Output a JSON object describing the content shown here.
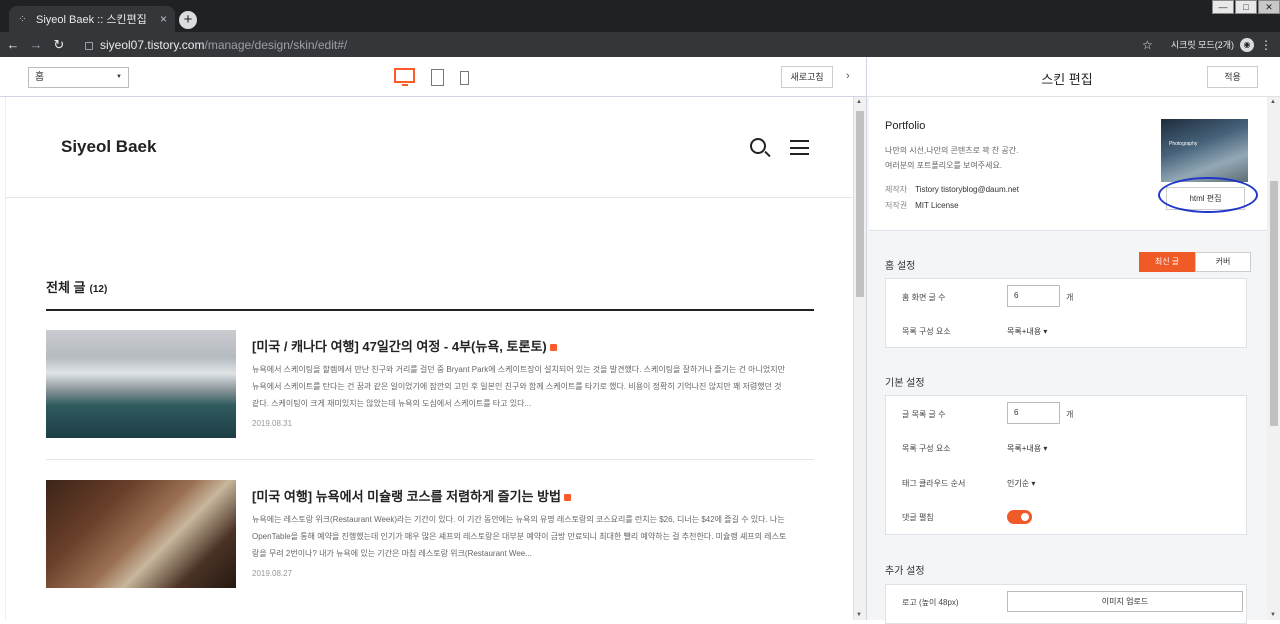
{
  "browser": {
    "tab_title": "Siyeol Baek :: 스킨편집",
    "tab_close": "×",
    "new_tab": "+",
    "url_host": "siyeol07.tistory.com",
    "url_path": "/manage/design/skin/edit#/",
    "incognito_label": "시크릿 모드(2개)",
    "window_controls": [
      "—",
      "□",
      "✕"
    ]
  },
  "toolbar": {
    "page_select": "홈",
    "refresh_label": "새로고침",
    "collapse_icon": "›"
  },
  "preview": {
    "blog_title": "Siyeol Baek",
    "section_title": "전체 글",
    "section_count": "(12)",
    "posts": [
      {
        "title": "[미국 / 캐나다 여행] 47일간의 여정 - 4부(뉴욕, 토론토)",
        "excerpt": "뉴욕에서 스케이팅을 할렘에서 만난 친구와 거리를 걸던 중 Bryant Park에 스케이트장이 설치되어 있는 것을 발견했다. 스케이팅을 잘하거나 즐기는 건 아니었지만 뉴욕에서 스케이트를 탄다는 건 꿈과 같은 일이었기에 잠깐의 고민 후 일본인 친구와 함께 스케이트를 타기로 했다. 비용이 정확히 기억나진 않지만 꽤 저렴했던 것 같다. 스케이팅이 크게 재미있지는 않았는데 뉴욕의 도심에서 스케이트를 타고 있다...",
        "date": "2019.08.31"
      },
      {
        "title": "[미국 여행] 뉴욕에서 미슐랭 코스를 저렴하게 즐기는 방법",
        "excerpt": "뉴욕에는 레스토랑 위크(Restaurant Week)라는 기간이 있다. 이 기간 동안에는 뉴욕의 유명 레스토랑의 코스요리를 런치는 $26, 디너는 $42에 즐길 수 있다. 나는 OpenTable을 통해 예약을 진행했는데 인기가 매우 많은 셰프의 레스토랑은 대부분 예약이 금방 만료되니 최대한 빨리 예약하는 걸 추천한다. 미슐랭 셰프의 레스토랑을 무려 2번이나? 내가 뉴욕에 있는 기간은 마침 레스토랑 위크(Restaurant Wee...",
        "date": "2019.08.27"
      }
    ]
  },
  "panel": {
    "title": "스킨 편집",
    "apply_label": "적용",
    "skin": {
      "name": "Portfolio",
      "desc_line1": "나만의 시선,나만의 콘텐츠로 꽉 찬 공간.",
      "desc_line2": "여러분의 포트폴리오를 보여주세요.",
      "maker_label": "제작자",
      "maker_value": "Tistory tistoryblog@daum.net",
      "license_label": "저작권",
      "license_value": "MIT License",
      "thumb_text": "Photography",
      "html_edit_label": "html 편집"
    },
    "home": {
      "label": "홈 설정",
      "seg_latest": "최신 글",
      "seg_cover": "커버",
      "count_label": "홈 화면 글 수",
      "count_value": "6",
      "unit": "개",
      "list_label": "목록 구성 요소",
      "list_value": "목록+내용"
    },
    "basic": {
      "label": "기본 설정",
      "count_label": "글 목록 글 수",
      "count_value": "6",
      "unit": "개",
      "list_label": "목록 구성 요소",
      "list_value": "목록+내용",
      "tag_label": "태그 클라우드 순서",
      "tag_value": "인기순",
      "comment_label": "댓글 펼침",
      "comment_on": true
    },
    "extra": {
      "label": "추가 설정",
      "logo_label": "로고 (높이 48px)",
      "upload_label": "이미지 업로드"
    }
  },
  "colors": {
    "accent": "#ef5a26",
    "annotation_circle": "#1f36c9"
  }
}
